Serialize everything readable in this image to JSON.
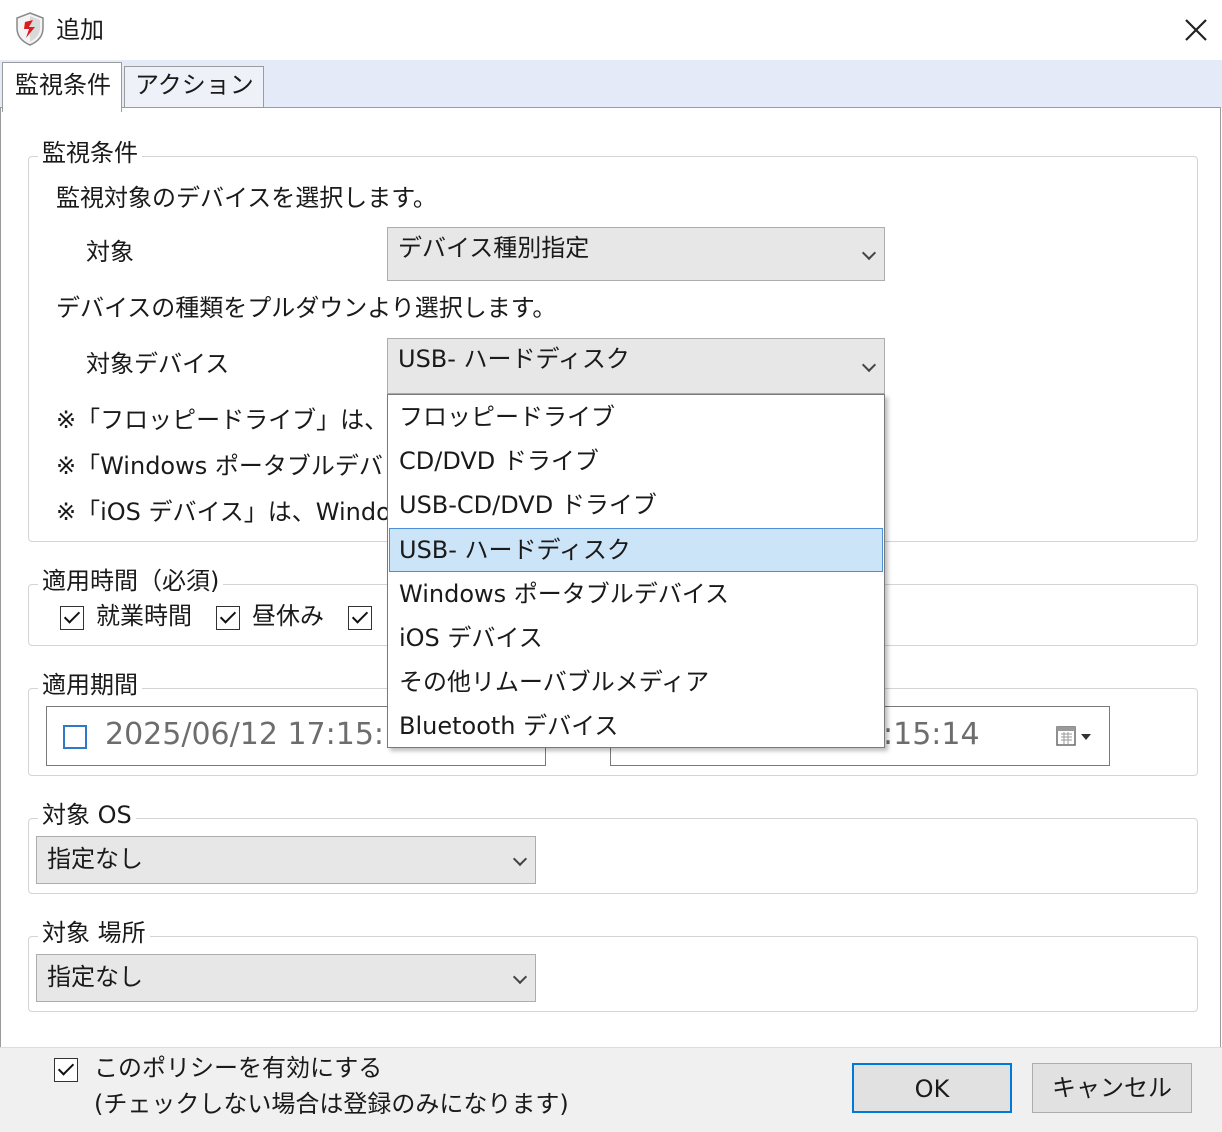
{
  "window": {
    "title": "追加",
    "icon": "shield-app-icon"
  },
  "tabs": [
    {
      "label": "監視条件",
      "active": true
    },
    {
      "label": "アクション",
      "active": false
    }
  ],
  "monitor_group": {
    "legend": "監視条件",
    "desc1": "監視対象のデバイスを選択します。",
    "target_label": "対象",
    "target_value": "デバイス種別指定",
    "desc2": "デバイスの種類をプルダウンより選択します。",
    "device_label": "対象デバイス",
    "device_value": "USB- ハードディスク",
    "note1": "※「フロッピードライブ」は、",
    "note2": "※「Windows ポータブルデバ",
    "note3": "※「iOS デバイス」は、Windo"
  },
  "time_group": {
    "legend": "適用時間（必須)",
    "items": [
      {
        "label": "就業時間",
        "checked": true
      },
      {
        "label": "昼休み",
        "checked": true
      },
      {
        "label": "",
        "checked": true
      }
    ]
  },
  "period_group": {
    "legend": "適用期間",
    "start_text": "2025/06/12 17:15:",
    "end_text": ":15:14",
    "start_enabled": false
  },
  "os_group": {
    "legend": "対象 OS",
    "value": "指定なし"
  },
  "location_group": {
    "legend": "対象 場所",
    "value": "指定なし"
  },
  "dropdown": {
    "options": [
      "フロッピードライブ",
      "CD/DVD ドライブ",
      "USB-CD/DVD ドライブ",
      "USB- ハードディスク",
      "Windows ポータブルデバイス",
      "iOS デバイス",
      "その他リムーバブルメディア",
      "Bluetooth デバイス"
    ],
    "selected_index": 3
  },
  "footer": {
    "enable_checked": true,
    "enable_label": "このポリシーを有効にする",
    "enable_note": "(チェックしない場合は登録のみになります)",
    "ok_label": "OK",
    "cancel_label": "キャンセル"
  },
  "colors": {
    "tab_strip": "#e4eaf7",
    "selected_option": "#cce4f7",
    "selected_border": "#4d8fd6",
    "accent": "#0078d7"
  }
}
